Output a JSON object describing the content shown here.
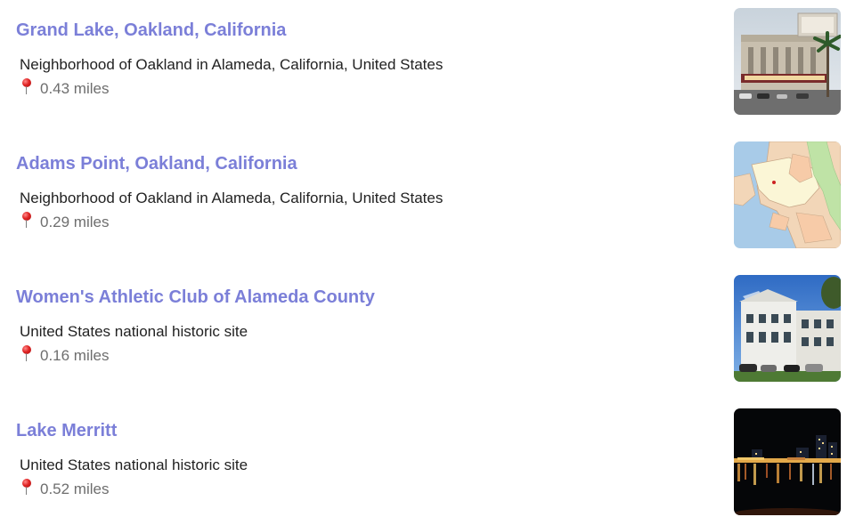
{
  "results": [
    {
      "title": "Grand Lake, Oakland, California",
      "description": "Neighborhood of Oakland in Alameda, California, United States",
      "distance": "0.43 miles",
      "thumbnail": "theater-photo"
    },
    {
      "title": "Adams Point, Oakland, California",
      "description": "Neighborhood of Oakland in Alameda, California, United States",
      "distance": "0.29 miles",
      "thumbnail": "map-image"
    },
    {
      "title": "Women's Athletic Club of Alameda County",
      "description": "United States national historic site",
      "distance": "0.16 miles",
      "thumbnail": "building-photo"
    },
    {
      "title": "Lake Merritt",
      "description": "United States national historic site",
      "distance": "0.52 miles",
      "thumbnail": "night-lake-photo"
    }
  ],
  "icons": {
    "distance": "map-pin-icon"
  },
  "colors": {
    "link": "#7b7fd8",
    "description": "#222222",
    "distance": "#6e6e6e",
    "pin": "#e02424"
  }
}
